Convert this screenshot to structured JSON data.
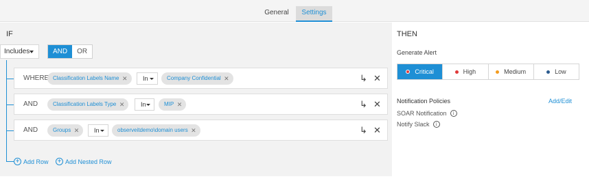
{
  "tabs": [
    {
      "label": "General"
    },
    {
      "label": "Settings"
    }
  ],
  "if_panel": {
    "title": "IF",
    "includes_label": "Includes",
    "logic": [
      "AND",
      "OR"
    ],
    "rows": [
      {
        "operator": "WHERE",
        "field": "Classification Labels Name",
        "comparator": "In",
        "value": "Company Confidential"
      },
      {
        "operator": "AND",
        "field": "Classification Labels Type",
        "comparator": "In",
        "value": "MIP"
      },
      {
        "operator": "AND",
        "field": "Groups",
        "comparator": "In",
        "value": "observeitdemo\\domain users"
      }
    ],
    "add_row_label": "Add Row",
    "add_nested_label": "Add Nested Row"
  },
  "then_panel": {
    "title": "THEN",
    "generate_alert_label": "Generate Alert",
    "severities": [
      {
        "label": "Critical",
        "color": "#e03a3a"
      },
      {
        "label": "High",
        "color": "#e03a3a"
      },
      {
        "label": "Medium",
        "color": "#f39c1f"
      },
      {
        "label": "Low",
        "color": "#2c5c8f"
      }
    ],
    "notification_policies_label": "Notification Policies",
    "add_edit_label": "Add/Edit",
    "policies": [
      "SOAR Notification",
      "Notify Slack"
    ]
  },
  "colors": {
    "accent": "#1e8fd5"
  }
}
